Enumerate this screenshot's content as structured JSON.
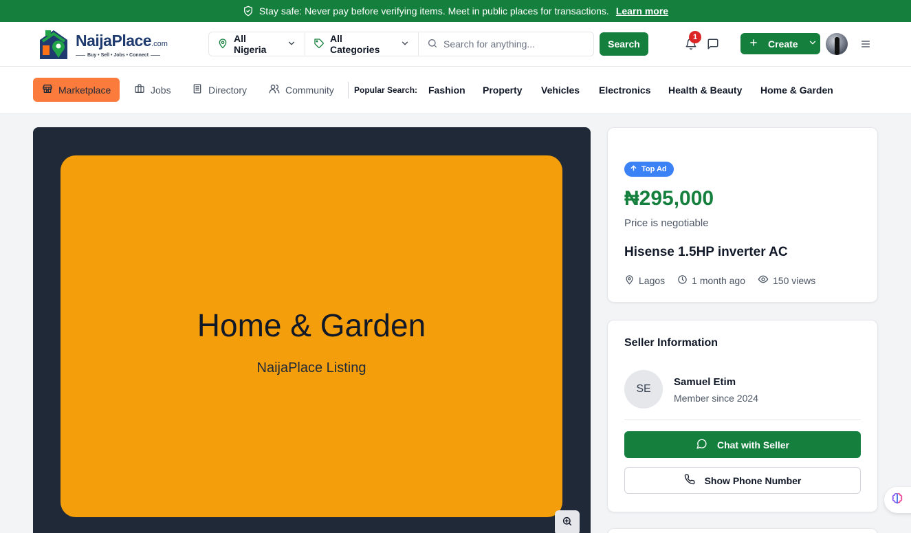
{
  "banner": {
    "text": "Stay safe: Never pay before verifying items. Meet in public places for transactions.",
    "link": "Learn more"
  },
  "header": {
    "logo": {
      "name": "NaijaPlace",
      "suffix": ".com",
      "tagline": "Buy • Sell • Jobs • Connect"
    },
    "location": "All Nigeria",
    "category": "All Categories",
    "search_placeholder": "Search for anything...",
    "search_button": "Search",
    "notifications_count": "1",
    "create_button": "Create"
  },
  "nav": {
    "items": [
      {
        "label": "Marketplace",
        "active": true
      },
      {
        "label": "Jobs"
      },
      {
        "label": "Directory"
      },
      {
        "label": "Community"
      }
    ],
    "popular_label": "Popular Search:",
    "popular": [
      "Fashion",
      "Property",
      "Vehicles",
      "Electronics",
      "Health & Beauty",
      "Home & Garden"
    ]
  },
  "gallery": {
    "title": "Home & Garden",
    "subtitle": "NaijaPlace Listing",
    "bg_color": "#f59e0b"
  },
  "listing": {
    "badge": "Top Ad",
    "price": "₦295,000",
    "negotiable": "Price is negotiable",
    "title": "Hisense 1.5HP inverter AC",
    "location": "Lagos",
    "posted": "1 month ago",
    "views": "150 views"
  },
  "seller": {
    "heading": "Seller Information",
    "initials": "SE",
    "name": "Samuel Etim",
    "since": "Member since 2024",
    "chat_button": "Chat with Seller",
    "phone_button": "Show Phone Number"
  },
  "colors": {
    "brand": "#15803d",
    "accent": "#fb7b3c",
    "badge": "#3b82f6"
  }
}
